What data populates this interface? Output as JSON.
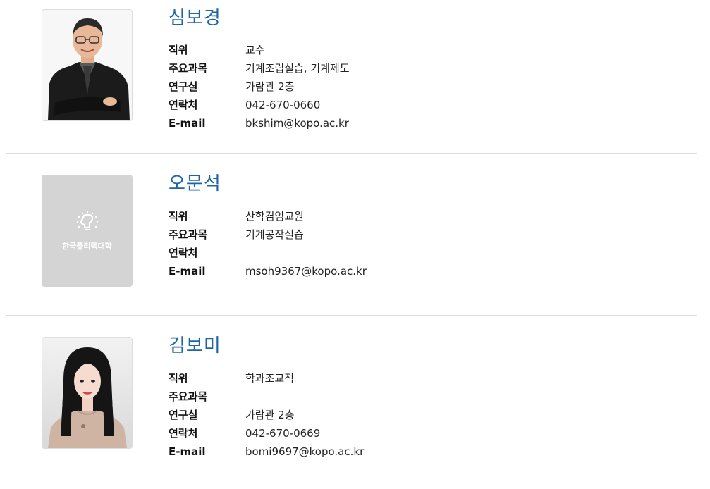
{
  "people": [
    {
      "name": "심보경",
      "photo": "portrait-man-glasses",
      "fields": [
        {
          "label": "직위",
          "value": "교수"
        },
        {
          "label": "주요과목",
          "value": "기계조립실습, 기계제도"
        },
        {
          "label": "연구실",
          "value": "가람관 2층"
        },
        {
          "label": "연락처",
          "value": "042-670-0660"
        },
        {
          "label": "E-mail",
          "value": "bkshim@kopo.ac.kr"
        }
      ]
    },
    {
      "name": "오문석",
      "photo": "placeholder-logo",
      "photo_text": "한국폴리텍대학",
      "fields": [
        {
          "label": "직위",
          "value": "산학겸임교원"
        },
        {
          "label": "주요과목",
          "value": "기계공작실습"
        },
        {
          "label": "연락처",
          "value": ""
        },
        {
          "label": "E-mail",
          "value": "msoh9367@kopo.ac.kr"
        }
      ]
    },
    {
      "name": "김보미",
      "photo": "portrait-woman",
      "fields": [
        {
          "label": "직위",
          "value": "학과조교직"
        },
        {
          "label": "주요과목",
          "value": ""
        },
        {
          "label": "연구실",
          "value": "가람관 2층"
        },
        {
          "label": "연락처",
          "value": "042-670-0669"
        },
        {
          "label": "E-mail",
          "value": "bomi9697@kopo.ac.kr"
        }
      ]
    }
  ],
  "colors": {
    "name": "#1d64a8",
    "divider": "#dedede",
    "placeholder_bg": "#d4d4d4"
  }
}
